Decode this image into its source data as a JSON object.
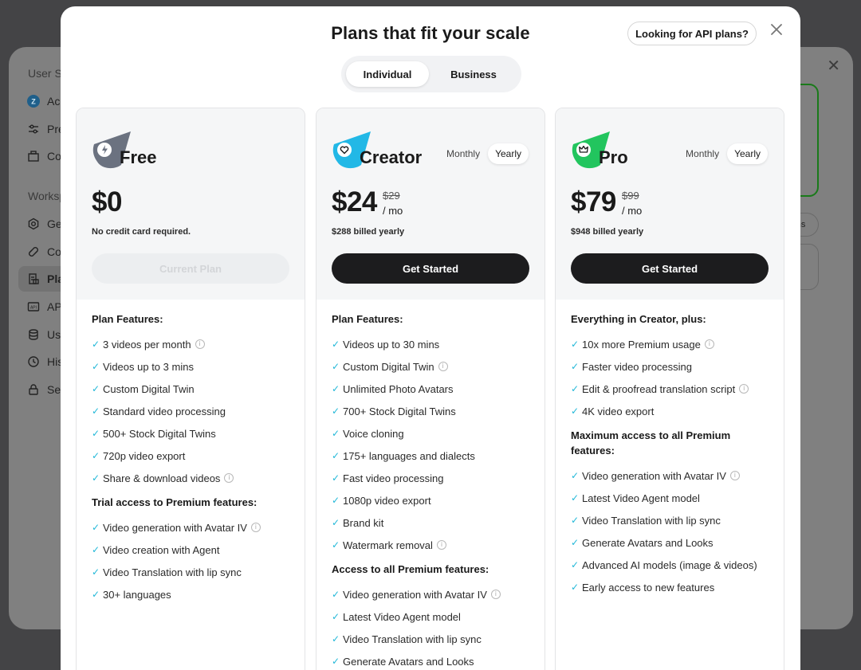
{
  "background": {
    "sections": [
      "User Se",
      "Worksp"
    ],
    "items": [
      {
        "label": "Ac",
        "icon": "account-icon"
      },
      {
        "label": "Pre",
        "icon": "sliders-icon"
      },
      {
        "label": "Co",
        "icon": "box-icon"
      },
      {
        "label": "Ge",
        "icon": "gear-icon"
      },
      {
        "label": "Co",
        "icon": "link-icon"
      },
      {
        "label": "Pla",
        "icon": "plan-icon"
      },
      {
        "label": "API",
        "icon": "api-icon"
      },
      {
        "label": "Us",
        "icon": "database-icon"
      },
      {
        "label": "His",
        "icon": "history-icon"
      },
      {
        "label": "Se",
        "icon": "lock-icon"
      }
    ],
    "pill_label": "-ons"
  },
  "modal": {
    "title": "Plans that fit your scale",
    "api_button": "Looking for API plans?",
    "tabs": [
      {
        "label": "Individual"
      },
      {
        "label": "Business"
      }
    ]
  },
  "plans": [
    {
      "name": "Free",
      "price": "$0",
      "note": "No credit card required.",
      "cta": "Current Plan",
      "color": "#6b7280",
      "sections": [
        {
          "heading": "Plan Features:",
          "features": [
            {
              "text": "3 videos per month",
              "info": true
            },
            {
              "text": "Videos up to 3 mins"
            },
            {
              "text": "Custom Digital Twin"
            },
            {
              "text": "Standard video processing"
            },
            {
              "text": "500+ Stock Digital Twins"
            },
            {
              "text": "720p video export"
            },
            {
              "text": "Share & download videos",
              "info": true
            }
          ]
        },
        {
          "heading": "Trial access to Premium features:",
          "features": [
            {
              "text": "Video generation with Avatar IV",
              "info": true
            },
            {
              "text": "Video creation with Agent"
            },
            {
              "text": "Video Translation with lip sync"
            },
            {
              "text": "30+ languages"
            }
          ]
        }
      ]
    },
    {
      "name": "Creator",
      "price": "$24",
      "old_price": "$29",
      "per": "/ mo",
      "note": "$288 billed yearly",
      "toggle_monthly": "Monthly",
      "toggle_yearly": "Yearly",
      "cta": "Get Started",
      "color": "#22b8e6",
      "sections": [
        {
          "heading": "Plan Features:",
          "features": [
            {
              "text": "Videos up to 30 mins"
            },
            {
              "text": "Custom Digital Twin",
              "info": true
            },
            {
              "text": "Unlimited Photo Avatars"
            },
            {
              "text": "700+ Stock Digital Twins"
            },
            {
              "text": "Voice cloning"
            },
            {
              "text": "175+ languages and dialects"
            },
            {
              "text": "Fast video processing"
            },
            {
              "text": "1080p video export"
            },
            {
              "text": "Brand kit"
            },
            {
              "text": "Watermark removal",
              "info": true
            }
          ]
        },
        {
          "heading": "Access to all Premium features:",
          "features": [
            {
              "text": "Video generation with Avatar IV",
              "info": true
            },
            {
              "text": "Latest Video Agent model"
            },
            {
              "text": "Video Translation with lip sync"
            },
            {
              "text": "Generate Avatars and Looks"
            }
          ]
        }
      ]
    },
    {
      "name": "Pro",
      "price": "$79",
      "old_price": "$99",
      "per": "/ mo",
      "note": "$948 billed yearly",
      "toggle_monthly": "Monthly",
      "toggle_yearly": "Yearly",
      "cta": "Get Started",
      "color": "#22c55e",
      "sections": [
        {
          "heading": "Everything in Creator, plus:",
          "features": [
            {
              "text": "10x more Premium usage",
              "info": true
            },
            {
              "text": "Faster video processing"
            },
            {
              "text": "Edit & proofread translation script",
              "info": true
            },
            {
              "text": "4K video export"
            }
          ]
        },
        {
          "heading": "Maximum access to all Premium features:",
          "features": [
            {
              "text": "Video generation with Avatar IV",
              "info": true
            },
            {
              "text": "Latest Video Agent model"
            },
            {
              "text": "Video Translation with lip sync"
            },
            {
              "text": "Generate Avatars and Looks"
            },
            {
              "text": "Advanced AI models (image & videos)"
            },
            {
              "text": "Early access to new features"
            }
          ]
        }
      ]
    }
  ]
}
